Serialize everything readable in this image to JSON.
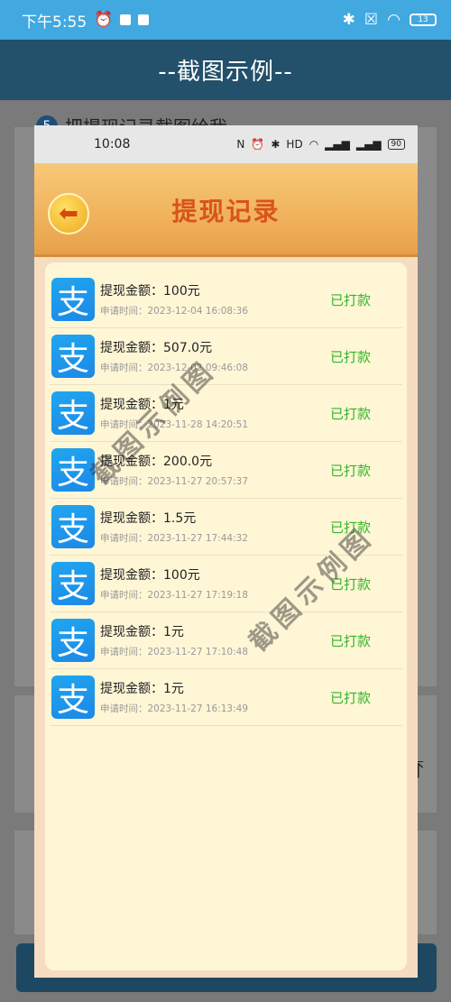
{
  "os_status": {
    "time": "下午5:55",
    "battery": "13"
  },
  "header": {
    "title": "--截图示例--"
  },
  "background": {
    "step_number": "5",
    "step_text": "把提现记录截图给我",
    "scroll_top_icon": "arrow-up-to-top-icon"
  },
  "screenshot": {
    "status_time": "10:08",
    "status_battery": "90",
    "title": "提现记录",
    "back_icon": "arrow-left-icon",
    "records": [
      {
        "amount": "提现金额：100元",
        "time": "申请时间：2023-12-04 16:08:36",
        "status": "已打款"
      },
      {
        "amount": "提现金额：507.0元",
        "time": "申请时间：2023-12-02 09:46:08",
        "status": "已打款"
      },
      {
        "amount": "提现金额：1元",
        "time": "申请时间：2023-11-28 14:20:51",
        "status": "已打款"
      },
      {
        "amount": "提现金额：200.0元",
        "time": "申请时间：2023-11-27 20:57:37",
        "status": "已打款"
      },
      {
        "amount": "提现金额：1.5元",
        "time": "申请时间：2023-11-27 17:44:32",
        "status": "已打款"
      },
      {
        "amount": "提现金额：100元",
        "time": "申请时间：2023-11-27 17:19:18",
        "status": "已打款"
      },
      {
        "amount": "提现金额：1元",
        "time": "申请时间：2023-11-27 17:10:48",
        "status": "已打款"
      },
      {
        "amount": "提现金额：1元",
        "time": "申请时间：2023-11-27 16:13:49",
        "status": "已打款"
      }
    ]
  },
  "watermark": {
    "text": "截图示例图"
  },
  "colors": {
    "status_bar": "#41a8e0",
    "header": "#23506b",
    "paid": "#35b529",
    "title": "#d9541b"
  }
}
